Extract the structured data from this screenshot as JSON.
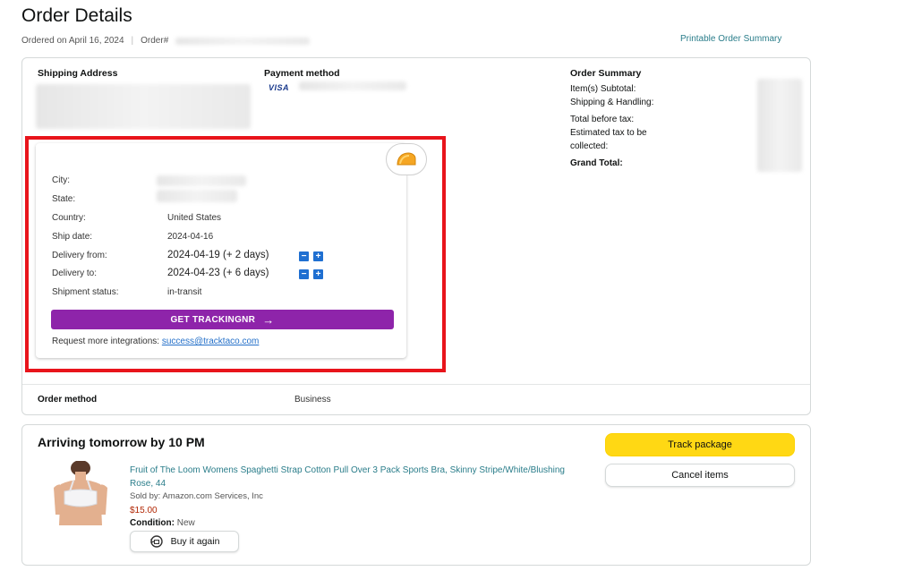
{
  "page": {
    "title": "Order Details",
    "ordered_on": "Ordered on April 16, 2024",
    "separator": "|",
    "order_label": "Order#",
    "printable_link": "Printable Order Summary"
  },
  "main": {
    "shipping_address_label": "Shipping Address",
    "payment_method_label": "Payment method",
    "visa_badge": "VISA",
    "order_summary_label": "Order Summary",
    "summary_lines": [
      "Item(s) Subtotal:",
      "Shipping & Handling:",
      "Total before tax:",
      "Estimated tax to be collected:"
    ],
    "grand_total_label": "Grand Total:",
    "order_method_label": "Order method",
    "order_method_value": "Business"
  },
  "tracking": {
    "rows": [
      {
        "label": "City:",
        "value": ""
      },
      {
        "label": "State:",
        "value": ""
      },
      {
        "label": "Country:",
        "value": "United States"
      },
      {
        "label": "Ship date:",
        "value": "2024-04-16"
      },
      {
        "label": "Delivery from:",
        "value": "2024-04-19 (+ 2 days)"
      },
      {
        "label": "Delivery to:",
        "value": "2024-04-23 (+ 6 days)"
      },
      {
        "label": "Shipment status:",
        "value": "in-transit"
      }
    ],
    "minus": "−",
    "plus": "+",
    "button_label": "GET TRACKINGNR",
    "button_arrow": "→",
    "request_text": "Request more integrations:",
    "request_email": "success@tracktaco.com",
    "accent": "#8e24aa",
    "outline_color": "#e8141b"
  },
  "shipment": {
    "arriving": "Arriving tomorrow by 10 PM",
    "track_button": "Track package",
    "cancel_button": "Cancel items",
    "product_title": "Fruit of The Loom Womens Spaghetti Strap Cotton Pull Over 3 Pack Sports Bra, Skinny Stripe/White/Blushing Rose, 44",
    "sold_by": "Sold by: Amazon.com Services, Inc",
    "price": "$15.00",
    "condition_label": "Condition:",
    "condition_value": "New",
    "buy_again": "Buy it again"
  }
}
